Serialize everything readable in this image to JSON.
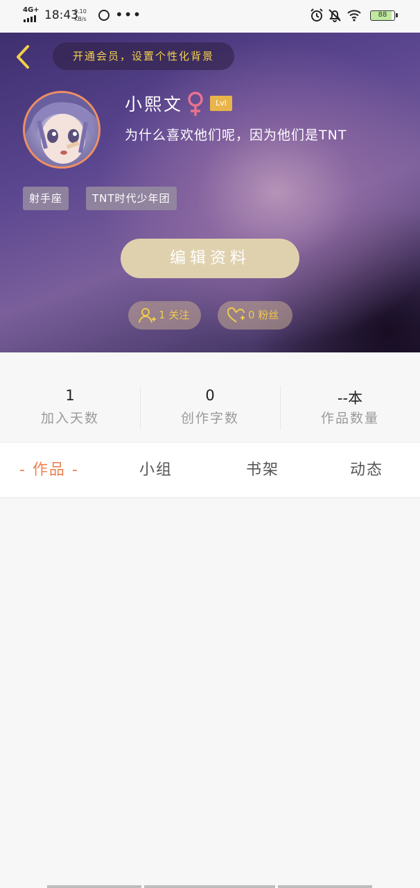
{
  "status_bar": {
    "network": "4G+",
    "time": "18:43",
    "speed_value": "0.10",
    "speed_unit": "KB/s",
    "more": "•••",
    "battery": "88",
    "icons": [
      "app-icon",
      "alarm-icon",
      "mute-icon",
      "wifi-icon",
      "battery-icon"
    ]
  },
  "header": {
    "vip_banner": "开通会员，设置个性化背景",
    "username": "小熙文",
    "gender_symbol": "♀",
    "level": "Lvl",
    "bio": "为什么喜欢他们呢，因为他们是TNT",
    "tags": [
      "射手座",
      "TNT时代少年团"
    ],
    "edit_button": "编辑资料",
    "follow_label": "1 关注",
    "fans_label": "0 粉丝",
    "colors": {
      "accent": "#f0cb4c",
      "avatar_ring": "#ee8f63",
      "edit_button": "#e0d1ae"
    }
  },
  "stats": [
    {
      "value": "1",
      "label": "加入天数"
    },
    {
      "value": "0",
      "label": "创作字数"
    },
    {
      "value": "--本",
      "label": "作品数量"
    }
  ],
  "tabs": [
    {
      "label": "- 作品 -",
      "active": true
    },
    {
      "label": "小组",
      "active": false
    },
    {
      "label": "书架",
      "active": false
    },
    {
      "label": "动态",
      "active": false
    }
  ],
  "colors": {
    "active_tab": "#ee8152",
    "background": "#f7f7f7"
  }
}
